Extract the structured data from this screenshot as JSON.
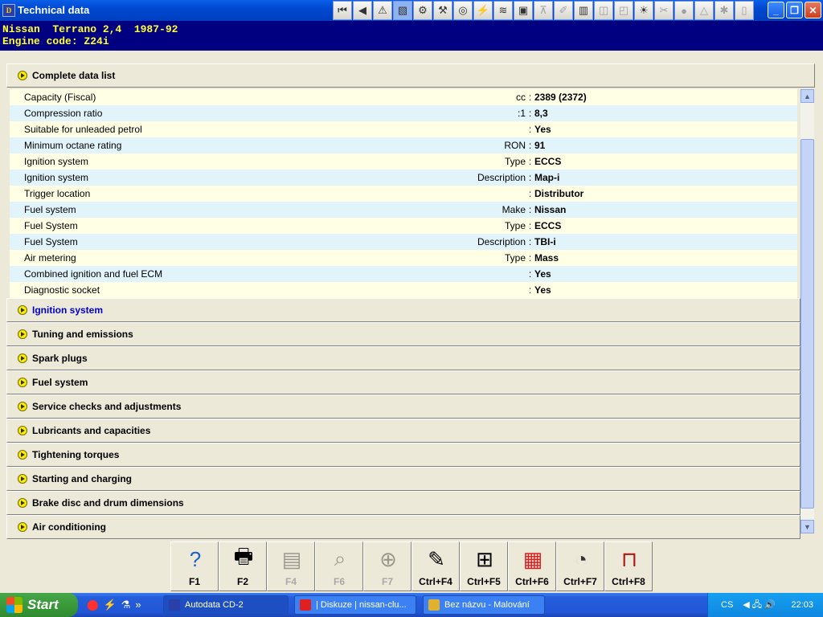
{
  "window": {
    "title": "Technical data"
  },
  "vehicle": {
    "line1": "Nissan  Terrano 2,4  1987-92",
    "line2": "Engine code: Z24i"
  },
  "complete_section": {
    "label": "Complete data list"
  },
  "data_rows": [
    {
      "label": "Capacity (Fiscal)",
      "unit": "cc",
      "value": "2389 (2372)"
    },
    {
      "label": "Compression ratio",
      "unit": ":1",
      "value": "8,3"
    },
    {
      "label": "Suitable for unleaded petrol",
      "unit": "",
      "value": "Yes"
    },
    {
      "label": "Minimum octane rating",
      "unit": "RON",
      "value": "91"
    },
    {
      "label": "Ignition system",
      "unit": "Type",
      "value": "ECCS"
    },
    {
      "label": "Ignition system",
      "unit": "Description",
      "value": "Map-i"
    },
    {
      "label": "Trigger location",
      "unit": "",
      "value": "Distributor"
    },
    {
      "label": "Fuel system",
      "unit": "Make",
      "value": "Nissan"
    },
    {
      "label": "Fuel System",
      "unit": "Type",
      "value": "ECCS"
    },
    {
      "label": "Fuel System",
      "unit": "Description",
      "value": "TBI-i"
    },
    {
      "label": "Air metering",
      "unit": "Type",
      "value": "Mass"
    },
    {
      "label": "Combined ignition and fuel ECM",
      "unit": "",
      "value": "Yes"
    },
    {
      "label": "Diagnostic socket",
      "unit": "",
      "value": "Yes"
    }
  ],
  "sections": [
    {
      "label": "Ignition system",
      "color": "#0000cc"
    },
    {
      "label": "Tuning and emissions",
      "color": "#000000"
    },
    {
      "label": "Spark plugs",
      "color": "#000000"
    },
    {
      "label": "Fuel system",
      "color": "#000000"
    },
    {
      "label": "Service checks and adjustments",
      "color": "#000000"
    },
    {
      "label": "Lubricants and capacities",
      "color": "#000000"
    },
    {
      "label": "Tightening torques",
      "color": "#000000"
    },
    {
      "label": "Starting and charging",
      "color": "#000000"
    },
    {
      "label": "Brake disc and drum dimensions",
      "color": "#000000"
    },
    {
      "label": "Air conditioning",
      "color": "#000000"
    }
  ],
  "fkeys": [
    {
      "key": "F1",
      "icon": "help-icon",
      "glyph": "?",
      "enabled": true
    },
    {
      "key": "F2",
      "icon": "printer-icon",
      "glyph": "🖶",
      "enabled": true
    },
    {
      "key": "F4",
      "icon": "list-icon",
      "glyph": "▤",
      "enabled": false
    },
    {
      "key": "F6",
      "icon": "brief-search-icon",
      "glyph": "⌕",
      "enabled": false
    },
    {
      "key": "F7",
      "icon": "target-icon",
      "glyph": "⊕",
      "enabled": false
    },
    {
      "key": "Ctrl+F4",
      "icon": "notes-icon",
      "glyph": "✎",
      "enabled": true
    },
    {
      "key": "Ctrl+F5",
      "icon": "add-list-icon",
      "glyph": "⊞",
      "enabled": true
    },
    {
      "key": "Ctrl+F6",
      "icon": "calendar-icon",
      "glyph": "▦",
      "enabled": true
    },
    {
      "key": "Ctrl+F7",
      "icon": "gauges-icon",
      "glyph": "◔",
      "enabled": true
    },
    {
      "key": "Ctrl+F8",
      "icon": "car-lift-icon",
      "glyph": "⊓",
      "enabled": true
    }
  ],
  "taskbar": {
    "start_label": "Start",
    "tasks": [
      {
        "label": "Autodata CD-2",
        "active": true,
        "icon": "autodata-icon"
      },
      {
        "label": "| Diskuze | nissan-clu...",
        "active": false,
        "icon": "opera-icon"
      },
      {
        "label": "Bez názvu - Malování",
        "active": false,
        "icon": "paint-icon"
      }
    ],
    "language": "CS",
    "clock": "22:03"
  }
}
